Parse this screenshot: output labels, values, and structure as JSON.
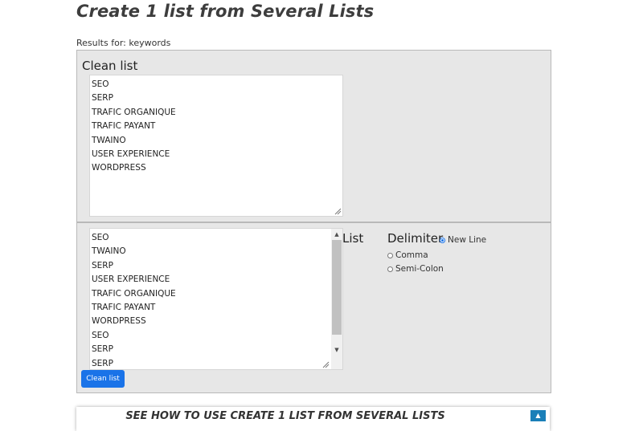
{
  "page": {
    "title": "Create 1 list from Several Lists",
    "results_label": "Results for: keywords"
  },
  "clean_panel": {
    "heading": "Clean list",
    "lines": [
      "SEO",
      "SERP",
      "TRAFIC ORGANIQUE",
      "TRAFIC PAYANT",
      "TWAINO",
      "USER EXPERIENCE",
      "WORDPRESS"
    ]
  },
  "input_panel": {
    "lines": [
      "SEO",
      "TWAINO",
      "SERP",
      "USER EXPERIENCE",
      "TRAFIC ORGANIQUE",
      "TRAFIC PAYANT",
      "WORDPRESS",
      "SEO",
      "SERP",
      "SERP"
    ],
    "list_label": "List",
    "delimiter_label": "Delimiter",
    "delimiter_options": [
      {
        "label": "New Line",
        "checked": true
      },
      {
        "label": "Comma",
        "checked": false
      },
      {
        "label": "Semi-Colon",
        "checked": false
      }
    ],
    "button_label": "Clean list"
  },
  "howto": {
    "title": "SEE HOW TO USE CREATE 1 LIST FROM SEVERAL LISTS",
    "toggle_icon": "caret-up-icon"
  },
  "colors": {
    "accent": "#1a73e8",
    "panel_bg": "#e7e7e7",
    "toggle_bg": "#1a7fb8"
  }
}
